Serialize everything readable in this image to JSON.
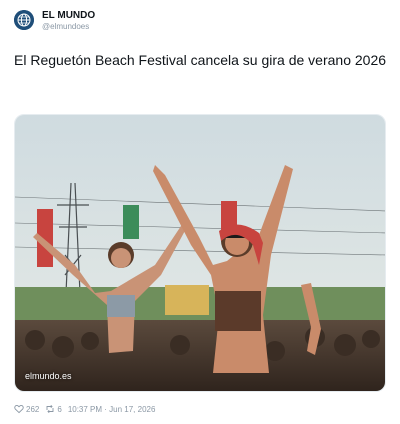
{
  "account": {
    "display_name": "EL MUNDO",
    "handle": "@elmundoes",
    "avatar_icon": "globe-icon",
    "avatar_color": "#1f4e79"
  },
  "tweet": {
    "text": "El Reguetón Beach Festival cancela su gira de verano 2026"
  },
  "media": {
    "source_label": "elmundo.es",
    "description_icon": "festival-photo"
  },
  "footer": {
    "likes_icon": "heart-icon",
    "likes": "262",
    "retweets_icon": "retweet-icon",
    "retweets": "6",
    "timestamp": "10:37 PM · Jun 17, 2026"
  },
  "colors": {
    "text": "#0f1419",
    "muted": "#8b98a5"
  }
}
